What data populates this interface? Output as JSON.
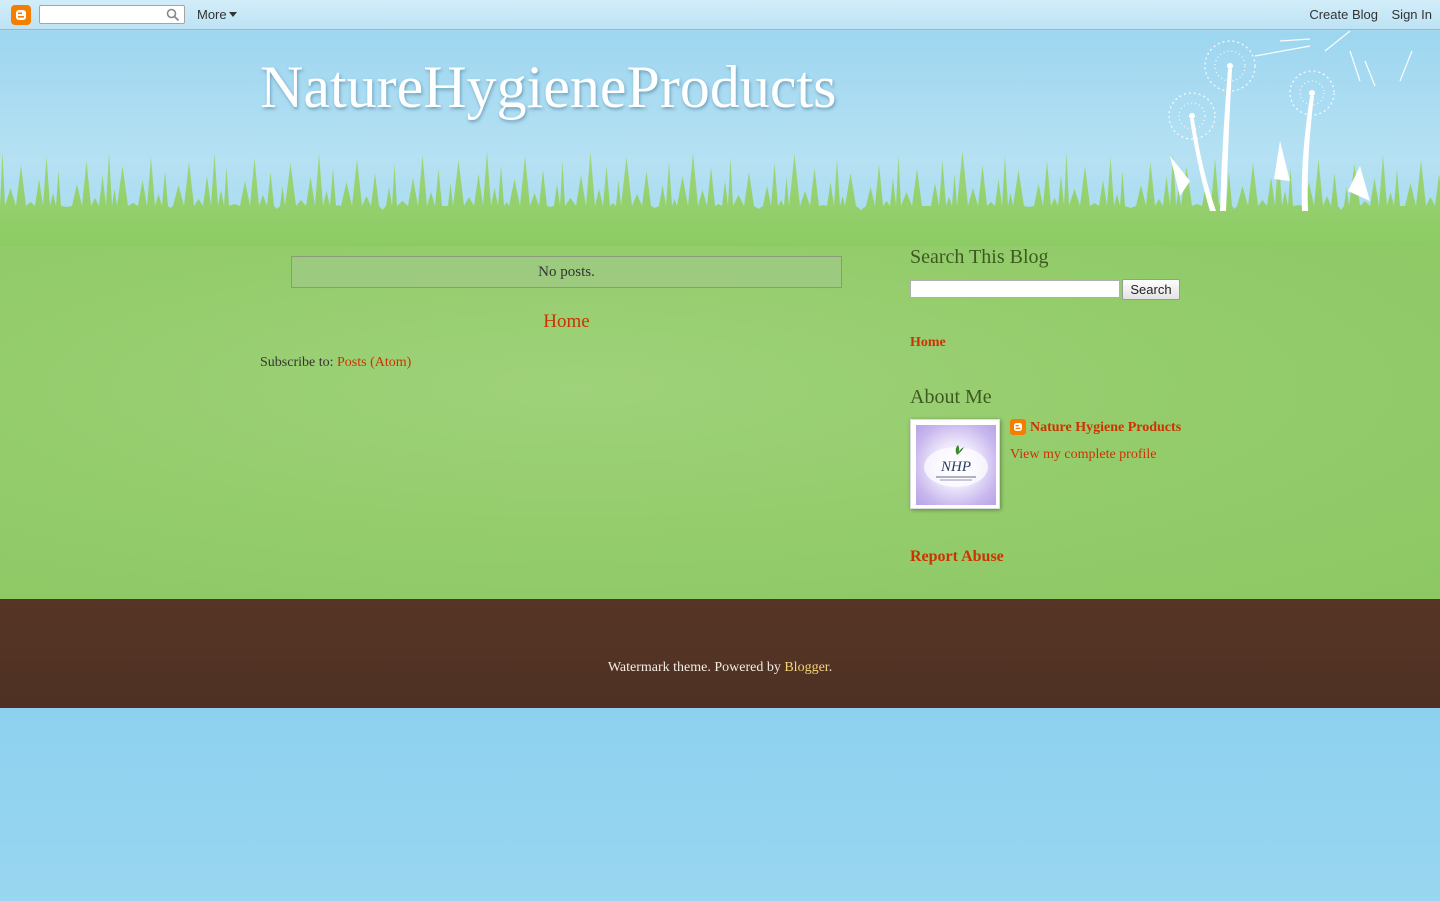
{
  "navbar": {
    "search_placeholder": "",
    "more_label": "More",
    "create_blog_label": "Create Blog",
    "sign_in_label": "Sign In"
  },
  "header": {
    "title": "NatureHygieneProducts"
  },
  "main": {
    "no_posts": "No posts.",
    "home_link": "Home",
    "subscribe_prefix": "Subscribe to: ",
    "subscribe_link": "Posts (Atom)"
  },
  "sidebar": {
    "search_title": "Search This Blog",
    "search_button": "Search",
    "home_link": "Home",
    "about_title": "About Me",
    "profile_name": "Nature Hygiene Products",
    "view_profile": "View my complete profile",
    "report_abuse": "Report Abuse"
  },
  "footer": {
    "prefix": "Watermark theme. Powered by ",
    "link": "Blogger",
    "suffix": "."
  },
  "colors": {
    "link": "#cc3300",
    "heading": "#3d5a1e",
    "footer_bg": "#563526",
    "grass": "#8cc864",
    "sky": "#8fd2ef"
  }
}
